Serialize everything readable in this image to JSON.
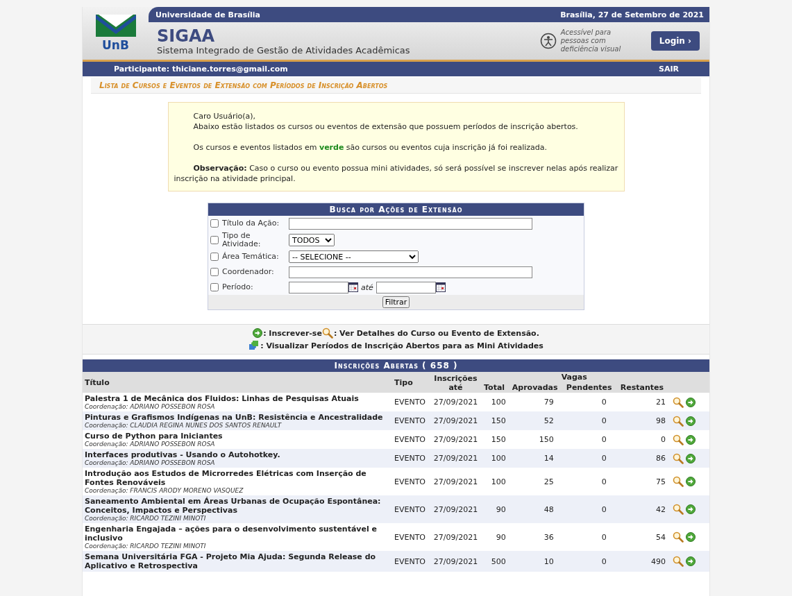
{
  "header": {
    "university": "Universidade de Brasília",
    "date": "Brasília, 27 de Setembro de 2021",
    "logo_text": "UnB",
    "system_name": "SIGAA",
    "system_full_name": "Sistema Integrado de Gestão de Atividades Acadêmicas",
    "accessibility": "Acessível para pessoas com deficiência visual",
    "login_button": "Login ›"
  },
  "user_bar": {
    "participant": "Participante: thiciane.torres@gmail.com",
    "logout": "SAIR"
  },
  "page_title": "Lista de Cursos e Eventos de Extensão com Períodos de Inscrição Abertos",
  "info_box": {
    "greeting": "Caro Usuário(a),",
    "intro": "Abaixo estão listados os cursos ou eventos de extensão que possuem períodos de inscrição abertos.",
    "legend_note": {
      "before": "Os cursos e eventos listados em ",
      "highlight": "verde",
      "after": " são cursos ou eventos cuja inscrição já foi realizada."
    },
    "observation": "**Observação:** Caso o curso ou evento possua mini atividades, só será possível se inscrever nelas após realizar inscrição na atividade principal."
  },
  "search_form": {
    "title": "Busca por Ações de Extensão",
    "fields": [
      {
        "kind": "text",
        "label": "Título da Ação:",
        "checked": false
      },
      {
        "kind": "select",
        "label": "Tipo de Atividade:",
        "checked": false,
        "value": "TODOS"
      },
      {
        "kind": "wideselect",
        "label": "Área Temática:",
        "checked": false,
        "value": "-- SELECIONE --"
      },
      {
        "kind": "text",
        "label": "Coordenador:",
        "checked": false
      },
      {
        "kind": "period",
        "label": "Período:",
        "checked": false,
        "separator": "até"
      }
    ],
    "button": "Filtrar"
  },
  "legend": [
    [
      {
        "kind": "enroll",
        "text": ": Inscrever-se"
      },
      {
        "kind": "details",
        "text": ": Ver Detalhes do Curso ou Evento de Extensão."
      }
    ],
    [
      {
        "kind": "mini",
        "text": ": Visualizar Períodos de Inscrição Abertos para as Mini Atividades"
      }
    ]
  ],
  "table": {
    "title": "Inscrições Abertas ( 658 )",
    "group_header": "Vagas",
    "columns": [
      "Título",
      "Tipo",
      "Inscrições até",
      "Total",
      "Aprovadas",
      "Pendentes",
      "Restantes"
    ],
    "rows": [
      {
        "title": "Palestra 1 de Mecânica dos Fluidos: Linhas de Pesquisas Atuais",
        "coordinator": "Coordenação: ADRIANO POSSEBON ROSA",
        "type": "EVENTO",
        "until": "27/09/2021",
        "total": "100",
        "approved": "79",
        "pending": "0",
        "remaining": "21"
      },
      {
        "title": "Pinturas e Grafismos Indígenas na UnB: Resistência e Ancestralidade",
        "coordinator": "Coordenação: CLAUDIA REGINA NUNES DOS SANTOS RENAULT",
        "type": "EVENTO",
        "until": "27/09/2021",
        "total": "150",
        "approved": "52",
        "pending": "0",
        "remaining": "98"
      },
      {
        "title": "Curso de Python para Iniciantes",
        "coordinator": "Coordenação: ADRIANO POSSEBON ROSA",
        "type": "EVENTO",
        "until": "27/09/2021",
        "total": "150",
        "approved": "150",
        "pending": "0",
        "remaining": "0"
      },
      {
        "title": "Interfaces produtivas - Usando o Autohotkey.",
        "coordinator": "Coordenação: ADRIANO POSSEBON ROSA",
        "type": "EVENTO",
        "until": "27/09/2021",
        "total": "100",
        "approved": "14",
        "pending": "0",
        "remaining": "86"
      },
      {
        "title": "Introdução aos Estudos de Microrredes Elétricas com Inserção de Fontes Renováveis",
        "coordinator": "Coordenação: FRANCIS ARODY MORENO VASQUEZ",
        "type": "EVENTO",
        "until": "27/09/2021",
        "total": "100",
        "approved": "25",
        "pending": "0",
        "remaining": "75"
      },
      {
        "title": "Saneamento Ambiental em Áreas Urbanas de Ocupação Espontânea: Conceitos, Impactos e Perspectivas",
        "coordinator": "Coordenação: RICARDO TEZINI MINOTI",
        "type": "EVENTO",
        "until": "27/09/2021",
        "total": "90",
        "approved": "48",
        "pending": "0",
        "remaining": "42"
      },
      {
        "title": "Engenharia Engajada – ações para o desenvolvimento sustentável e inclusivo",
        "coordinator": "Coordenação: RICARDO TEZINI MINOTI",
        "type": "EVENTO",
        "until": "27/09/2021",
        "total": "90",
        "approved": "36",
        "pending": "0",
        "remaining": "54"
      },
      {
        "title": "Semana Universitária FGA - Projeto Mia Ajuda: Segunda Release do Aplicativo e Retrospectiva",
        "type": "EVENTO",
        "until": "27/09/2021",
        "total": "500",
        "approved": "10",
        "pending": "0",
        "remaining": "490"
      }
    ]
  }
}
